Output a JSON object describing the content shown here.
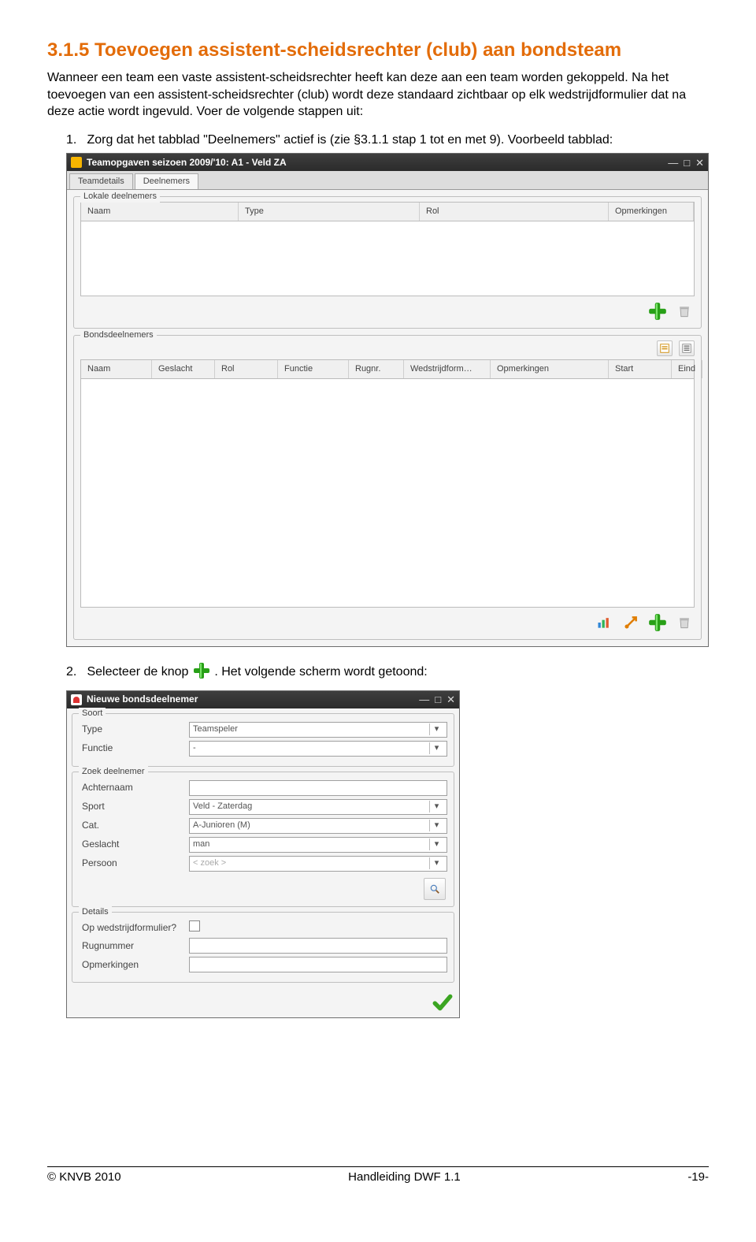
{
  "heading": "3.1.5 Toevoegen assistent-scheidsrechter (club) aan bondsteam",
  "para": "Wanneer een team een vaste assistent-scheidsrechter heeft kan deze aan een team worden gekoppeld. Na het toevoegen van een assistent-scheidsrechter (club) wordt deze standaard zichtbaar op elk wedstrijdformulier dat na deze actie wordt ingevuld. Voer de volgende stappen uit:",
  "step1": "Zorg dat het tabblad \"Deelnemers\" actief is (zie §3.1.1 stap 1 tot en met 9). Voorbeeld tabblad:",
  "step2a": "Selecteer de knop ",
  "step2b": ". Het volgende scherm wordt getoond:",
  "win1": {
    "title": "Teamopgaven seizoen 2009/'10: A1 - Veld ZA",
    "tabs": {
      "teamdetails": "Teamdetails",
      "deelnemers": "Deelnemers"
    },
    "gb1": {
      "legend": "Lokale deelnemers",
      "cols": {
        "naam": "Naam",
        "type": "Type",
        "rol": "Rol",
        "opm": "Opmerkingen"
      }
    },
    "gb2": {
      "legend": "Bondsdeelnemers",
      "cols": {
        "naam": "Naam",
        "gesl": "Geslacht",
        "rol": "Rol",
        "func": "Functie",
        "rug": "Rugnr.",
        "wed": "Wedstrijdform…",
        "opm": "Opmerkingen",
        "start": "Start",
        "eind": "Eind"
      }
    }
  },
  "win2": {
    "title": "Nieuwe bondsdeelnemer",
    "gb_soort": {
      "legend": "Soort",
      "type_lbl": "Type",
      "type_val": "Teamspeler",
      "func_lbl": "Functie",
      "func_val": "-"
    },
    "gb_zoek": {
      "legend": "Zoek deelnemer",
      "achternaam_lbl": "Achternaam",
      "sport_lbl": "Sport",
      "sport_val": "Veld - Zaterdag",
      "cat_lbl": "Cat.",
      "cat_val": "A-Junioren (M)",
      "geslacht_lbl": "Geslacht",
      "geslacht_val": "man",
      "persoon_lbl": "Persoon",
      "persoon_val": "< zoek >"
    },
    "gb_details": {
      "legend": "Details",
      "opwed_lbl": "Op wedstrijdformulier?",
      "rug_lbl": "Rugnummer",
      "opm_lbl": "Opmerkingen"
    }
  },
  "footer": {
    "left": "© KNVB 2010",
    "center": "Handleiding DWF 1.1",
    "right": "-19-"
  }
}
